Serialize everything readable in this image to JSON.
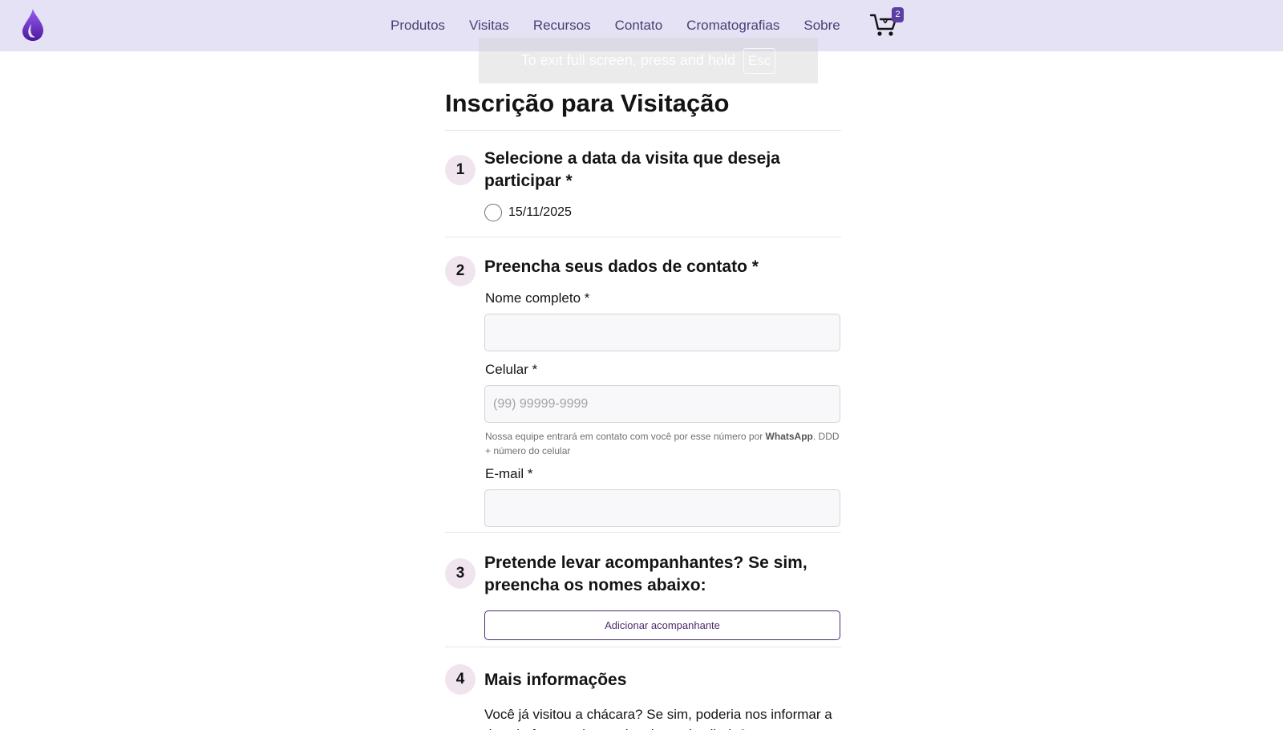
{
  "nav": {
    "links": [
      "Produtos",
      "Visitas",
      "Recursos",
      "Contato",
      "Cromatografias",
      "Sobre"
    ],
    "cart_count": "2"
  },
  "fullscreen_notice": {
    "text": "To exit full screen, press and hold",
    "key": "Esc"
  },
  "form": {
    "title": "Inscrição para Visitação",
    "step1": {
      "number": "1",
      "title": "Selecione a data da visita que deseja participar *",
      "option_label": "15/11/2025"
    },
    "step2": {
      "number": "2",
      "title": "Preencha seus dados de contato *",
      "name_label": "Nome completo *",
      "name_value": "",
      "phone_label": "Celular *",
      "phone_placeholder": "(99) 99999-9999",
      "phone_help_prefix": "Nossa equipe entrará em contato com você por esse número por ",
      "phone_help_bold": "WhatsApp",
      "phone_help_suffix": ". DDD + número do celular",
      "email_label": "E-mail *",
      "email_value": ""
    },
    "step3": {
      "number": "3",
      "title": "Pretende levar acompanhantes? Se sim, preencha os nomes abaixo:",
      "button_label": "Adicionar acompanhante"
    },
    "step4": {
      "number": "4",
      "title": "Mais informações",
      "text": "Você já visitou a chácara? Se sim, poderia nos informar a data (mês e ano) e qual a planta destilada?"
    }
  },
  "colors": {
    "nav_background": "#e4e2f4",
    "nav_text": "#4a3f73",
    "accent": "#5b3ea2",
    "step_circle": "#f0e5ef"
  },
  "icons": [
    "drop-logo-icon",
    "cart-icon"
  ]
}
